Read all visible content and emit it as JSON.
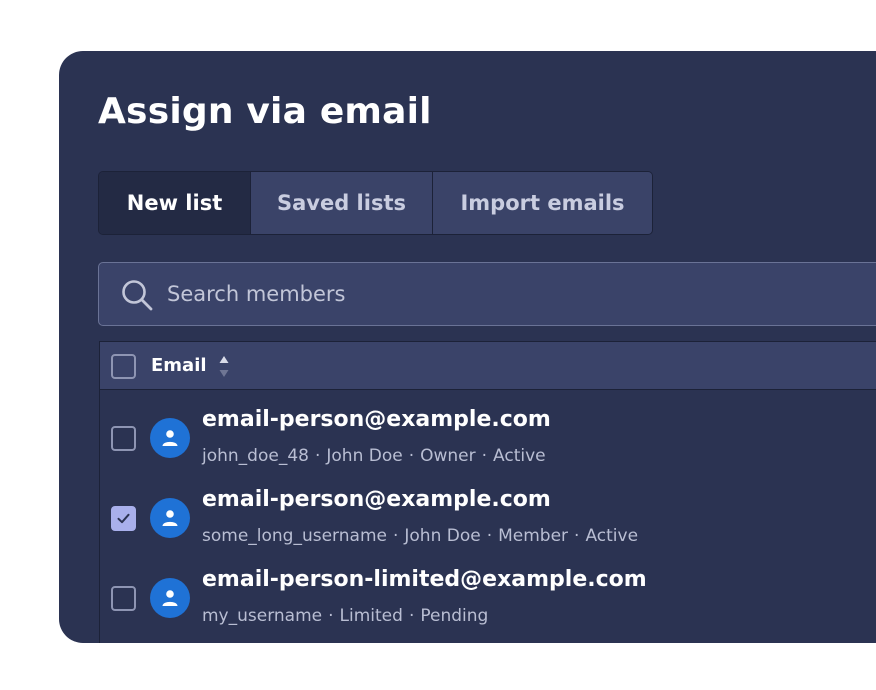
{
  "dialog": {
    "title": "Assign via email"
  },
  "tabs": [
    {
      "label": "New list",
      "active": true
    },
    {
      "label": "Saved lists",
      "active": false
    },
    {
      "label": "Import emails",
      "active": false
    }
  ],
  "search": {
    "placeholder": "Search members",
    "value": "",
    "icon": "search-icon"
  },
  "table": {
    "header": {
      "email_label": "Email",
      "sort_icon": "sort-icon",
      "select_all_checked": false
    },
    "rows": [
      {
        "checked": false,
        "avatar_icon": "user-icon",
        "email": "email-person@example.com",
        "username": "john_doe_48",
        "name": "John Doe",
        "role": "Owner",
        "status": "Active"
      },
      {
        "checked": true,
        "avatar_icon": "user-icon",
        "email": "email-person@example.com",
        "username": "some_long_username",
        "name": "John Doe",
        "role": "Member",
        "status": "Active"
      },
      {
        "checked": false,
        "avatar_icon": "user-icon",
        "email": "email-person-limited@example.com",
        "username": "my_username",
        "role": "Limited",
        "status": "Pending"
      }
    ]
  },
  "colors": {
    "panel_bg": "#2b3352",
    "header_bg": "#3a4369",
    "avatar_bg": "#1f72d6",
    "checkbox_checked": "#a9b0ec"
  }
}
